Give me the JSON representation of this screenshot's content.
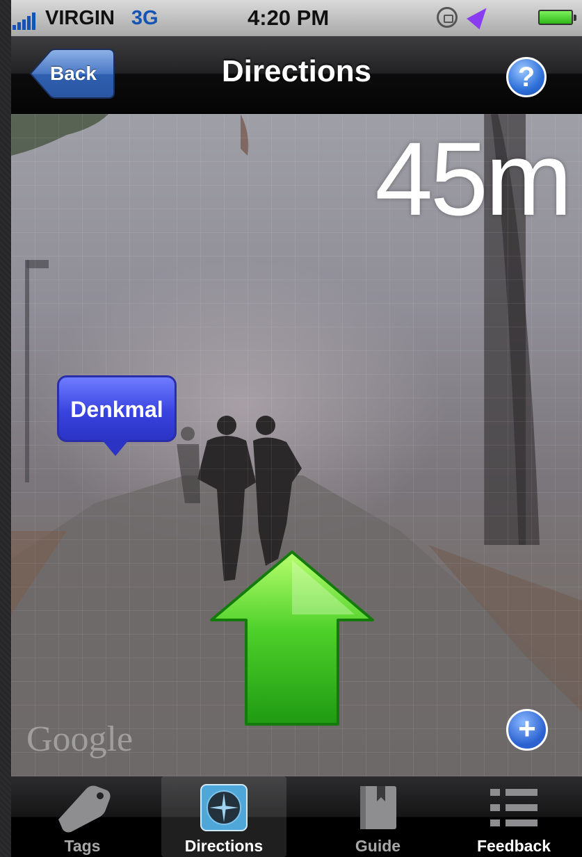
{
  "status_bar": {
    "carrier": "VIRGIN",
    "network": "3G",
    "time": "4:20 PM"
  },
  "nav_bar": {
    "back_label": "Back",
    "title": "Directions",
    "help_icon": "question-mark"
  },
  "view": {
    "distance": "45m",
    "poi_label": "Denkmal",
    "watermark": "Google",
    "add_icon": "plus",
    "direction_arrow": "green-up-arrow"
  },
  "tab_bar": {
    "tabs": [
      {
        "label": "Tags",
        "icon": "tag-icon",
        "selected": false
      },
      {
        "label": "Directions",
        "icon": "compass-icon",
        "selected": true
      },
      {
        "label": "Guide",
        "icon": "book-icon",
        "selected": false
      },
      {
        "label": "Feedback",
        "icon": "list-icon",
        "selected": false
      }
    ]
  },
  "colors": {
    "arrow": "#3ec41f",
    "poi_bubble": "#3944e0",
    "accent_blue": "#2e6fd9"
  }
}
